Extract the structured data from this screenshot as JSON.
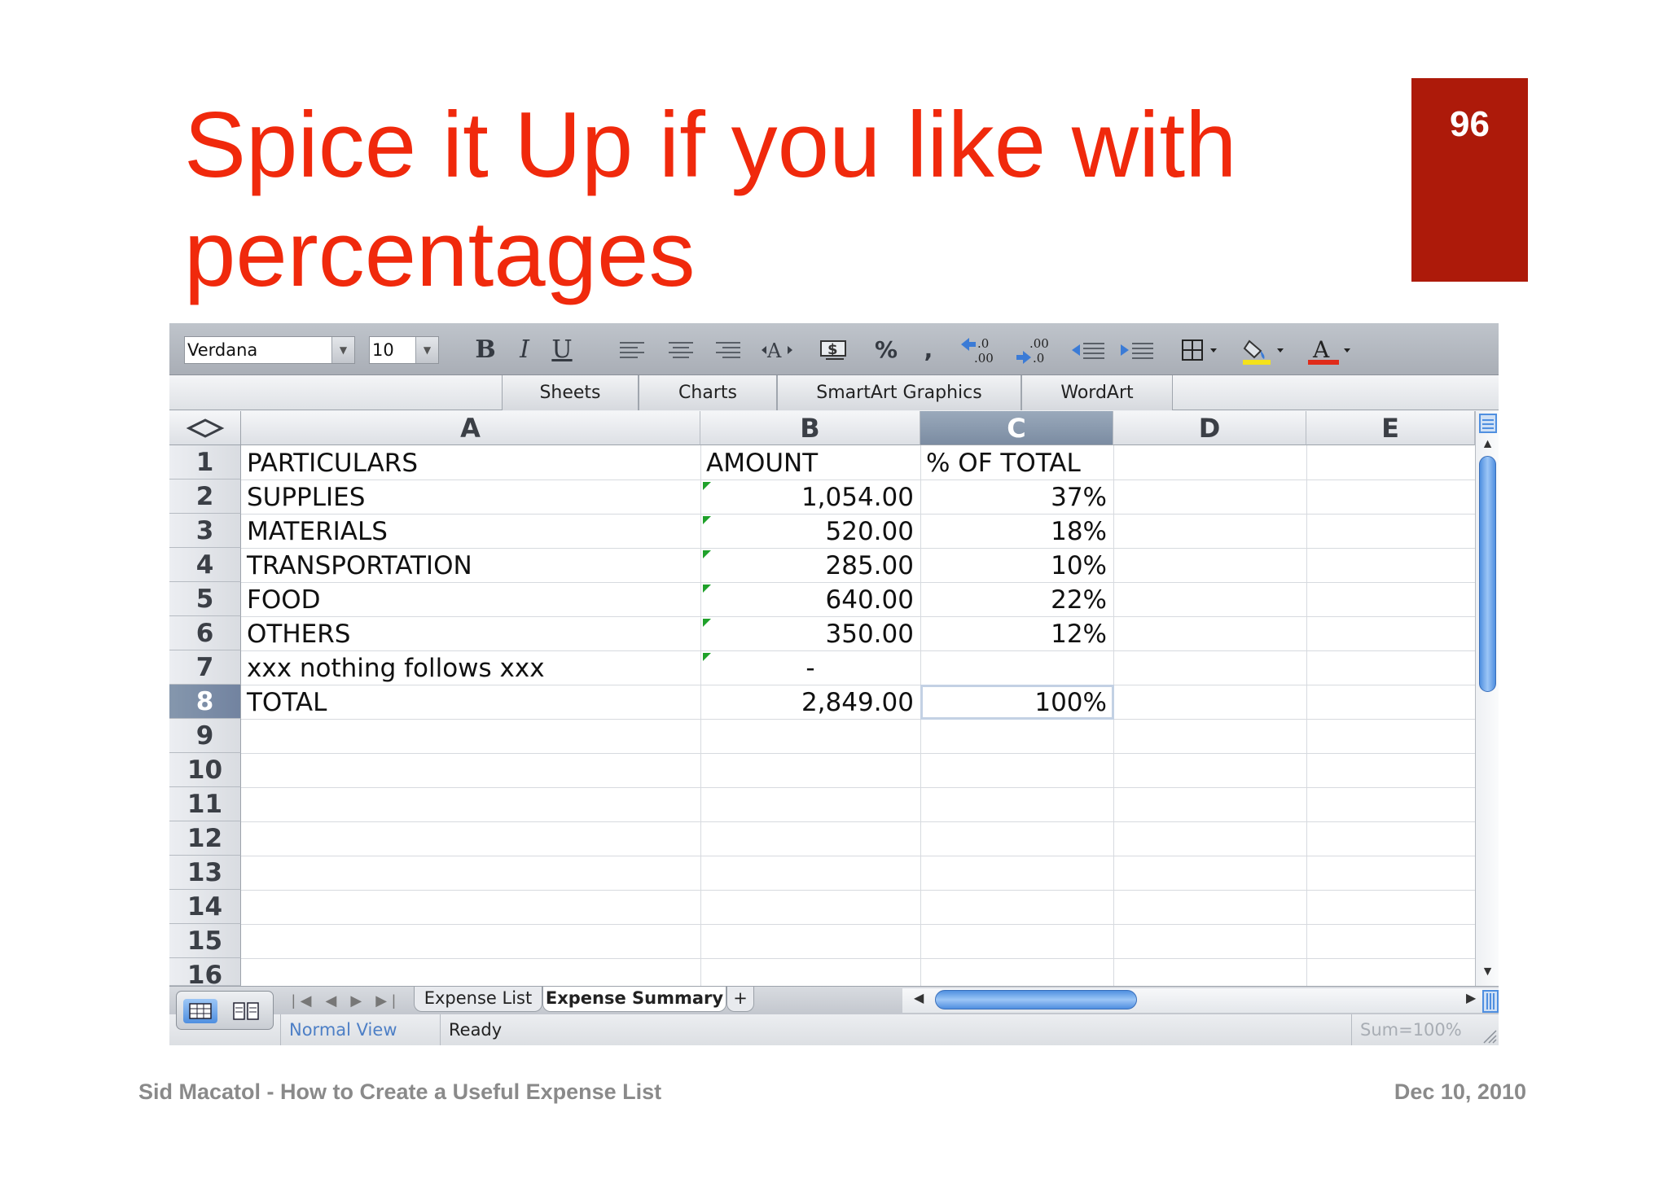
{
  "slide": {
    "title_line1": "Spice it Up if you like with",
    "title_line2": "percentages",
    "page_number": "96",
    "footer_left": "Sid Macatol - How to Create a Useful Expense List",
    "footer_right": "Dec 10, 2010",
    "title_color": "#f0290c",
    "page_box_color": "#ad1a0a"
  },
  "toolbar": {
    "font_name": "Verdana",
    "font_size": "10",
    "bold_label": "B",
    "italic_label": "I",
    "underline_label": "U",
    "percent_label": "%",
    "comma_label": ",",
    "font_color_label": "A",
    "icons": [
      "align-left-icon",
      "align-center-icon",
      "align-right-icon",
      "wrap-text-icon",
      "currency-icon",
      "percent-icon",
      "comma-style-icon",
      "increase-decimal-icon",
      "decrease-decimal-icon",
      "decrease-indent-icon",
      "increase-indent-icon",
      "borders-icon",
      "fill-color-icon",
      "font-color-icon"
    ]
  },
  "ribbon": {
    "tabs": [
      "Sheets",
      "Charts",
      "SmartArt Graphics",
      "WordArt"
    ]
  },
  "grid": {
    "columns": [
      "A",
      "B",
      "C",
      "D",
      "E"
    ],
    "selected_column": "C",
    "row_numbers": [
      "1",
      "2",
      "3",
      "4",
      "5",
      "6",
      "7",
      "8",
      "9",
      "10",
      "11",
      "12",
      "13",
      "14",
      "15",
      "16"
    ],
    "selected_row": "8",
    "rows": [
      {
        "a": "PARTICULARS",
        "b": "AMOUNT",
        "c": "% OF TOTAL"
      },
      {
        "a": "SUPPLIES",
        "b": "1,054.00",
        "c": "37%"
      },
      {
        "a": "MATERIALS",
        "b": "520.00",
        "c": "18%"
      },
      {
        "a": "TRANSPORTATION",
        "b": "285.00",
        "c": "10%"
      },
      {
        "a": "FOOD",
        "b": "640.00",
        "c": "22%"
      },
      {
        "a": "OTHERS",
        "b": "350.00",
        "c": "12%"
      },
      {
        "a": "xxx nothing follows xxx",
        "b": "-",
        "c": ""
      },
      {
        "a": "TOTAL",
        "b": "2,849.00",
        "c": "100%"
      }
    ],
    "active_cell": "C8"
  },
  "sheet_tabs": [
    "Expense List",
    "Expense Summary",
    "+"
  ],
  "active_sheet": "Expense Summary",
  "status": {
    "view": "Normal View",
    "state": "Ready",
    "sum": "Sum=100%"
  },
  "colors": {
    "error_indicator": "#1fa12a",
    "scroll_thumb": "#4f8fe0",
    "fill_color_swatch": "#f4e21b",
    "font_color_swatch": "#e02b1a"
  }
}
